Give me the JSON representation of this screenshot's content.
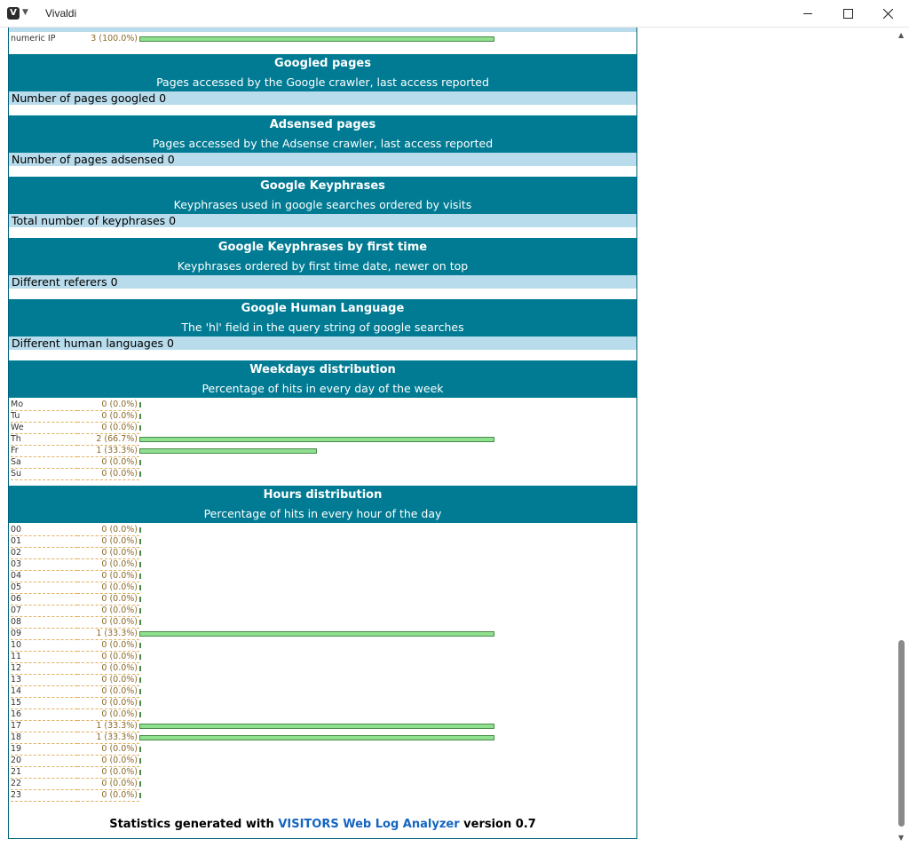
{
  "window": {
    "app_title": "Vivaldi"
  },
  "partial_top": {
    "label": "numeric IP",
    "value": "3 (100.0%)",
    "fraction": 1.0
  },
  "sections": [
    {
      "title": "Googled pages",
      "subtitle": "Pages accessed by the Google crawler, last access reported",
      "info": "Number of pages googled 0"
    },
    {
      "title": "Adsensed pages",
      "subtitle": "Pages accessed by the Adsense crawler, last access reported",
      "info": "Number of pages adsensed 0"
    },
    {
      "title": "Google Keyphrases",
      "subtitle": "Keyphrases used in google searches ordered by visits",
      "info": "Total number of keyphrases 0"
    },
    {
      "title": "Google Keyphrases by first time",
      "subtitle": "Keyphrases ordered by first time date, newer on top",
      "info": "Different referers 0"
    },
    {
      "title": "Google Human Language",
      "subtitle": "The 'hl' field in the query string of google searches",
      "info": "Different human languages 0"
    }
  ],
  "weekdays": {
    "title": "Weekdays distribution",
    "subtitle": "Percentage of hits in every day of the week",
    "rows": [
      {
        "label": "Mo",
        "value": "0 (0.0%)",
        "fraction": 0
      },
      {
        "label": "Tu",
        "value": "0 (0.0%)",
        "fraction": 0
      },
      {
        "label": "We",
        "value": "0 (0.0%)",
        "fraction": 0
      },
      {
        "label": "Th",
        "value": "2 (66.7%)",
        "fraction": 1.0
      },
      {
        "label": "Fr",
        "value": "1 (33.3%)",
        "fraction": 0.5
      },
      {
        "label": "Sa",
        "value": "0 (0.0%)",
        "fraction": 0
      },
      {
        "label": "Su",
        "value": "0 (0.0%)",
        "fraction": 0
      }
    ]
  },
  "hours": {
    "title": "Hours distribution",
    "subtitle": "Percentage of hits in every hour of the day",
    "rows": [
      {
        "label": "00",
        "value": "0 (0.0%)",
        "fraction": 0
      },
      {
        "label": "01",
        "value": "0 (0.0%)",
        "fraction": 0
      },
      {
        "label": "02",
        "value": "0 (0.0%)",
        "fraction": 0
      },
      {
        "label": "03",
        "value": "0 (0.0%)",
        "fraction": 0
      },
      {
        "label": "04",
        "value": "0 (0.0%)",
        "fraction": 0
      },
      {
        "label": "05",
        "value": "0 (0.0%)",
        "fraction": 0
      },
      {
        "label": "06",
        "value": "0 (0.0%)",
        "fraction": 0
      },
      {
        "label": "07",
        "value": "0 (0.0%)",
        "fraction": 0
      },
      {
        "label": "08",
        "value": "0 (0.0%)",
        "fraction": 0
      },
      {
        "label": "09",
        "value": "1 (33.3%)",
        "fraction": 1.0
      },
      {
        "label": "10",
        "value": "0 (0.0%)",
        "fraction": 0
      },
      {
        "label": "11",
        "value": "0 (0.0%)",
        "fraction": 0
      },
      {
        "label": "12",
        "value": "0 (0.0%)",
        "fraction": 0
      },
      {
        "label": "13",
        "value": "0 (0.0%)",
        "fraction": 0
      },
      {
        "label": "14",
        "value": "0 (0.0%)",
        "fraction": 0
      },
      {
        "label": "15",
        "value": "0 (0.0%)",
        "fraction": 0
      },
      {
        "label": "16",
        "value": "0 (0.0%)",
        "fraction": 0
      },
      {
        "label": "17",
        "value": "1 (33.3%)",
        "fraction": 1.0
      },
      {
        "label": "18",
        "value": "1 (33.3%)",
        "fraction": 1.0
      },
      {
        "label": "19",
        "value": "0 (0.0%)",
        "fraction": 0
      },
      {
        "label": "20",
        "value": "0 (0.0%)",
        "fraction": 0
      },
      {
        "label": "21",
        "value": "0 (0.0%)",
        "fraction": 0
      },
      {
        "label": "22",
        "value": "0 (0.0%)",
        "fraction": 0
      },
      {
        "label": "23",
        "value": "0 (0.0%)",
        "fraction": 0
      }
    ]
  },
  "footer": {
    "prefix": "Statistics generated with",
    "link_text": "VISITORS Web Log Analyzer",
    "suffix": "version 0.7"
  },
  "colors": {
    "header_bg": "#007b93",
    "info_bg": "#b8dcec",
    "bar_fill": "#8fe08f",
    "link": "#1565c0"
  },
  "icons": {
    "app": "vivaldi-logo-icon",
    "minimize": "minimize-icon",
    "maximize": "maximize-icon",
    "close": "close-icon"
  }
}
